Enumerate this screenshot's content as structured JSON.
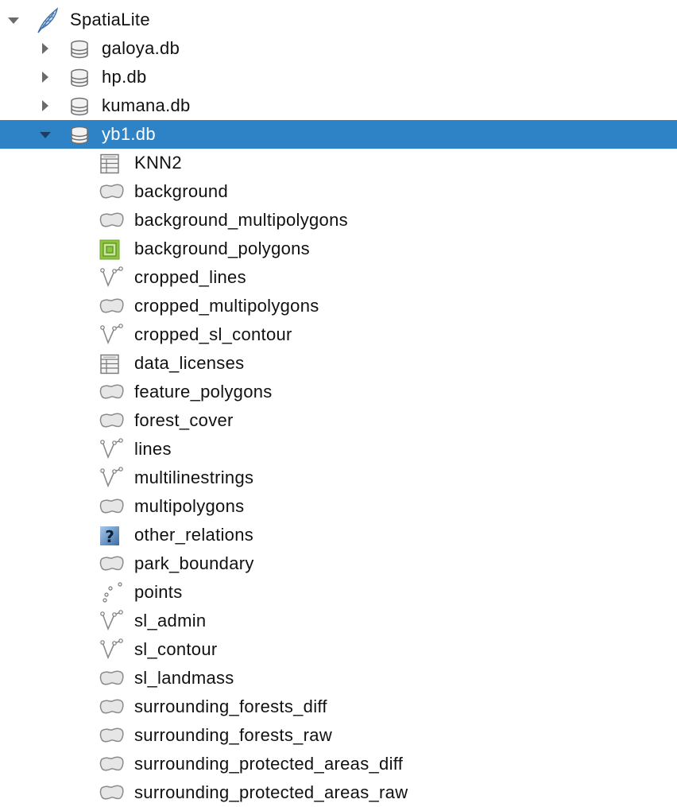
{
  "tree": {
    "root": {
      "label": "SpatiaLite",
      "icon": "feather-icon",
      "expanded": true
    },
    "databases": [
      {
        "label": "galoya.db",
        "icon": "database-icon",
        "expanded": false
      },
      {
        "label": "hp.db",
        "icon": "database-icon",
        "expanded": false
      },
      {
        "label": "kumana.db",
        "icon": "database-icon",
        "expanded": false
      },
      {
        "label": "yb1.db",
        "icon": "database-icon",
        "expanded": true,
        "selected": true
      }
    ],
    "layers": [
      {
        "label": "KNN2",
        "icon": "table-icon"
      },
      {
        "label": "background",
        "icon": "polygon-icon"
      },
      {
        "label": "background_multipolygons",
        "icon": "polygon-icon"
      },
      {
        "label": "background_polygons",
        "icon": "raster-polygon-icon"
      },
      {
        "label": "cropped_lines",
        "icon": "line-icon"
      },
      {
        "label": "cropped_multipolygons",
        "icon": "polygon-icon"
      },
      {
        "label": "cropped_sl_contour",
        "icon": "line-icon"
      },
      {
        "label": "data_licenses",
        "icon": "table-icon"
      },
      {
        "label": "feature_polygons",
        "icon": "polygon-icon"
      },
      {
        "label": "forest_cover",
        "icon": "polygon-icon"
      },
      {
        "label": "lines",
        "icon": "line-icon"
      },
      {
        "label": "multilinestrings",
        "icon": "line-icon"
      },
      {
        "label": "multipolygons",
        "icon": "polygon-icon"
      },
      {
        "label": "other_relations",
        "icon": "unknown-icon"
      },
      {
        "label": "park_boundary",
        "icon": "polygon-icon"
      },
      {
        "label": "points",
        "icon": "point-icon"
      },
      {
        "label": "sl_admin",
        "icon": "line-icon"
      },
      {
        "label": "sl_contour",
        "icon": "line-icon"
      },
      {
        "label": "sl_landmass",
        "icon": "polygon-icon"
      },
      {
        "label": "surrounding_forests_diff",
        "icon": "polygon-icon"
      },
      {
        "label": "surrounding_forests_raw",
        "icon": "polygon-icon"
      },
      {
        "label": "surrounding_protected_areas_diff",
        "icon": "polygon-icon"
      },
      {
        "label": "surrounding_protected_areas_raw",
        "icon": "polygon-icon"
      }
    ]
  },
  "colors": {
    "selection": "#2e83c6",
    "raster_icon": "#8cc63f",
    "unknown_icon": "#3b6ea8"
  }
}
